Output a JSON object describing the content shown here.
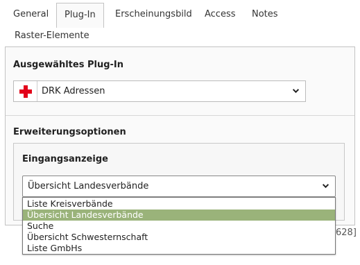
{
  "tabs": [
    {
      "label": "General"
    },
    {
      "label": "Plug-In",
      "active": true
    },
    {
      "label": "Erscheinungsbild"
    },
    {
      "label": "Access"
    },
    {
      "label": "Notes"
    },
    {
      "label": "Raster-Elemente"
    }
  ],
  "plugin_section": {
    "title": "Ausgewähltes Plug-In",
    "selected_plugin": "DRK Adressen",
    "icon": "red-cross-icon",
    "icon_color": "#e2001a"
  },
  "options_section": {
    "title": "Erweiterungsoptionen",
    "fieldset_title": "Eingangsanzeige",
    "selected_value": "Übersicht Landesverbände",
    "options": [
      {
        "label": "Liste Kreisverbände"
      },
      {
        "label": "Übersicht Landesverbände",
        "selected": true
      },
      {
        "label": "Suche"
      },
      {
        "label": "Übersicht Schwesternschaft"
      },
      {
        "label": "Liste GmbHs"
      }
    ],
    "highlight_color": "#9ab37a"
  },
  "partial_text": "628]"
}
